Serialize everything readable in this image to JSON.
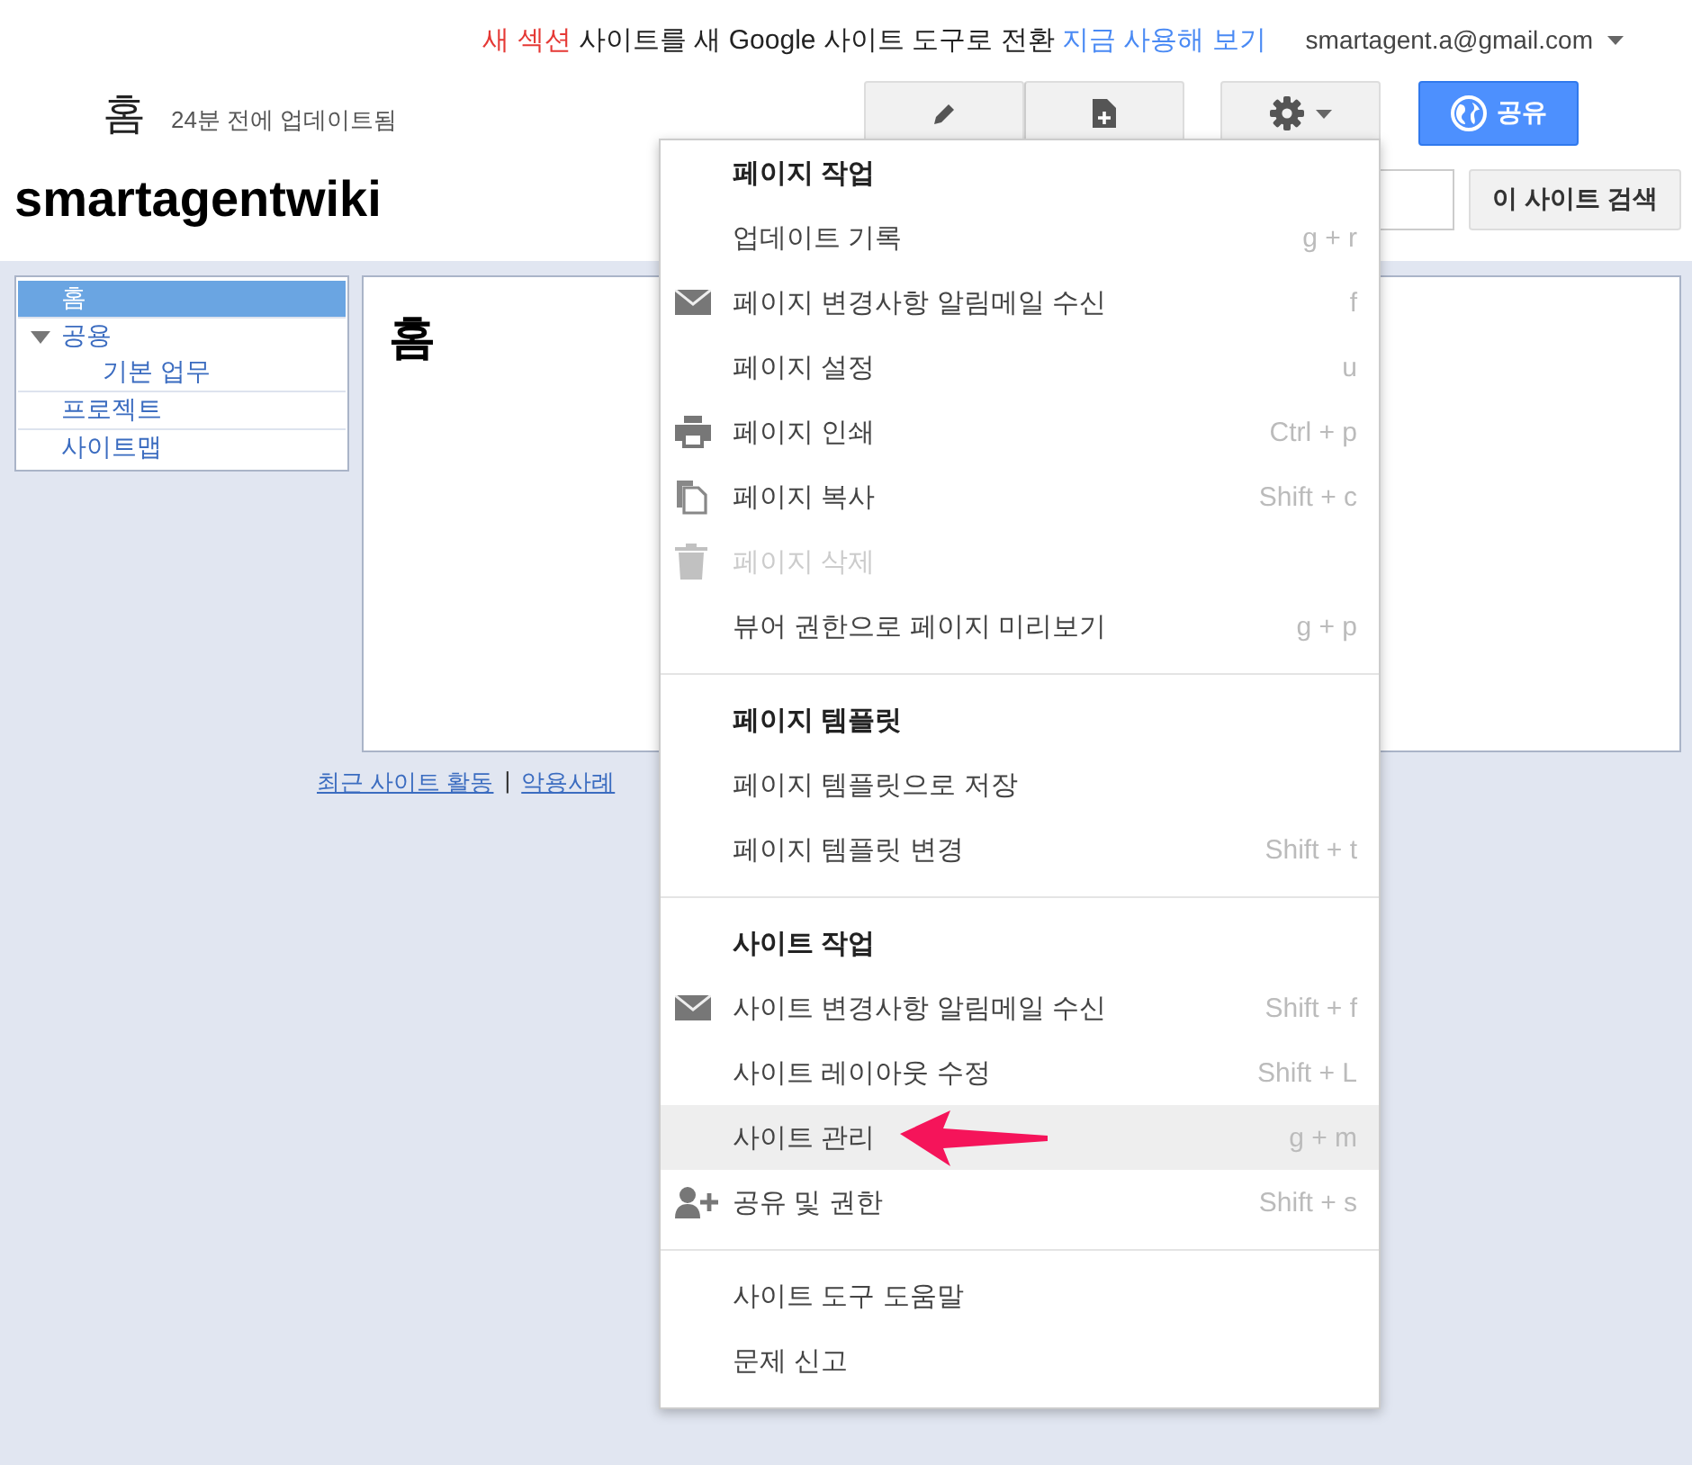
{
  "banner": {
    "highlight": "새 섹션",
    "text": "사이트를 새 Google 사이트 도구로 전환",
    "link": "지금 사용해 보기"
  },
  "account": {
    "email": "smartagent.a@gmail.com"
  },
  "page": {
    "title": "홈",
    "updated": "24분 전에 업데이트됨"
  },
  "toolbar": {
    "share_button": "공유"
  },
  "site_title": "smartagentwiki",
  "search": {
    "button": "이 사이트 검색"
  },
  "sidebar": {
    "items": [
      {
        "label": "홈",
        "selected": true
      },
      {
        "label": "공용",
        "selected": false,
        "expanded": true,
        "children": [
          {
            "label": "기본 업무",
            "selected": false
          }
        ]
      },
      {
        "label": "프로젝트",
        "selected": false
      },
      {
        "label": "사이트맵",
        "selected": false
      }
    ]
  },
  "content": {
    "heading": "홈"
  },
  "footer": {
    "links": [
      "최근 사이트 활동",
      "악용사례"
    ],
    "separator": "|"
  },
  "menu": {
    "sections": [
      {
        "items": [
          {
            "kind": "header",
            "label": "페이지 작업"
          },
          {
            "kind": "item",
            "label": "업데이트 기록",
            "shortcut": "g + r",
            "disabled": false,
            "selected": false
          },
          {
            "kind": "item",
            "label": "페이지 변경사항 알림메일 수신",
            "shortcut": "f",
            "disabled": false,
            "selected": false
          },
          {
            "kind": "item",
            "label": "페이지 설정",
            "shortcut": "u",
            "disabled": false,
            "selected": false
          },
          {
            "kind": "item",
            "label": "페이지 인쇄",
            "shortcut": "Ctrl + p",
            "disabled": false,
            "selected": false
          },
          {
            "kind": "item",
            "label": "페이지 복사",
            "shortcut": "Shift + c",
            "disabled": false,
            "selected": false
          },
          {
            "kind": "item",
            "label": "페이지 삭제",
            "disabled": true,
            "selected": false
          },
          {
            "kind": "item",
            "label": "뷰어 권한으로 페이지 미리보기",
            "shortcut": "g + p",
            "disabled": false,
            "selected": false
          }
        ]
      },
      {
        "items": [
          {
            "kind": "header",
            "label": "페이지 템플릿"
          },
          {
            "kind": "item",
            "label": "페이지 템플릿으로 저장",
            "disabled": false,
            "selected": false
          },
          {
            "kind": "item",
            "label": "페이지 템플릿 변경",
            "shortcut": "Shift + t",
            "disabled": false,
            "selected": false
          }
        ]
      },
      {
        "items": [
          {
            "kind": "header",
            "label": "사이트 작업"
          },
          {
            "kind": "item",
            "label": "사이트 변경사항 알림메일 수신",
            "shortcut": "Shift + f",
            "disabled": false,
            "selected": false
          },
          {
            "kind": "item",
            "label": "사이트 레이아웃 수정",
            "shortcut": "Shift + L",
            "disabled": false,
            "selected": false
          },
          {
            "kind": "item",
            "label": "사이트 관리",
            "shortcut": "g + m",
            "disabled": false,
            "selected": true
          },
          {
            "kind": "item",
            "label": "공유 및 권한",
            "shortcut": "Shift + s",
            "disabled": false,
            "selected": false
          }
        ]
      },
      {
        "items": [
          {
            "kind": "item",
            "label": "사이트 도구 도움말",
            "disabled": false,
            "selected": false
          },
          {
            "kind": "item",
            "label": "문제 신고",
            "disabled": false,
            "selected": false
          }
        ]
      }
    ]
  }
}
